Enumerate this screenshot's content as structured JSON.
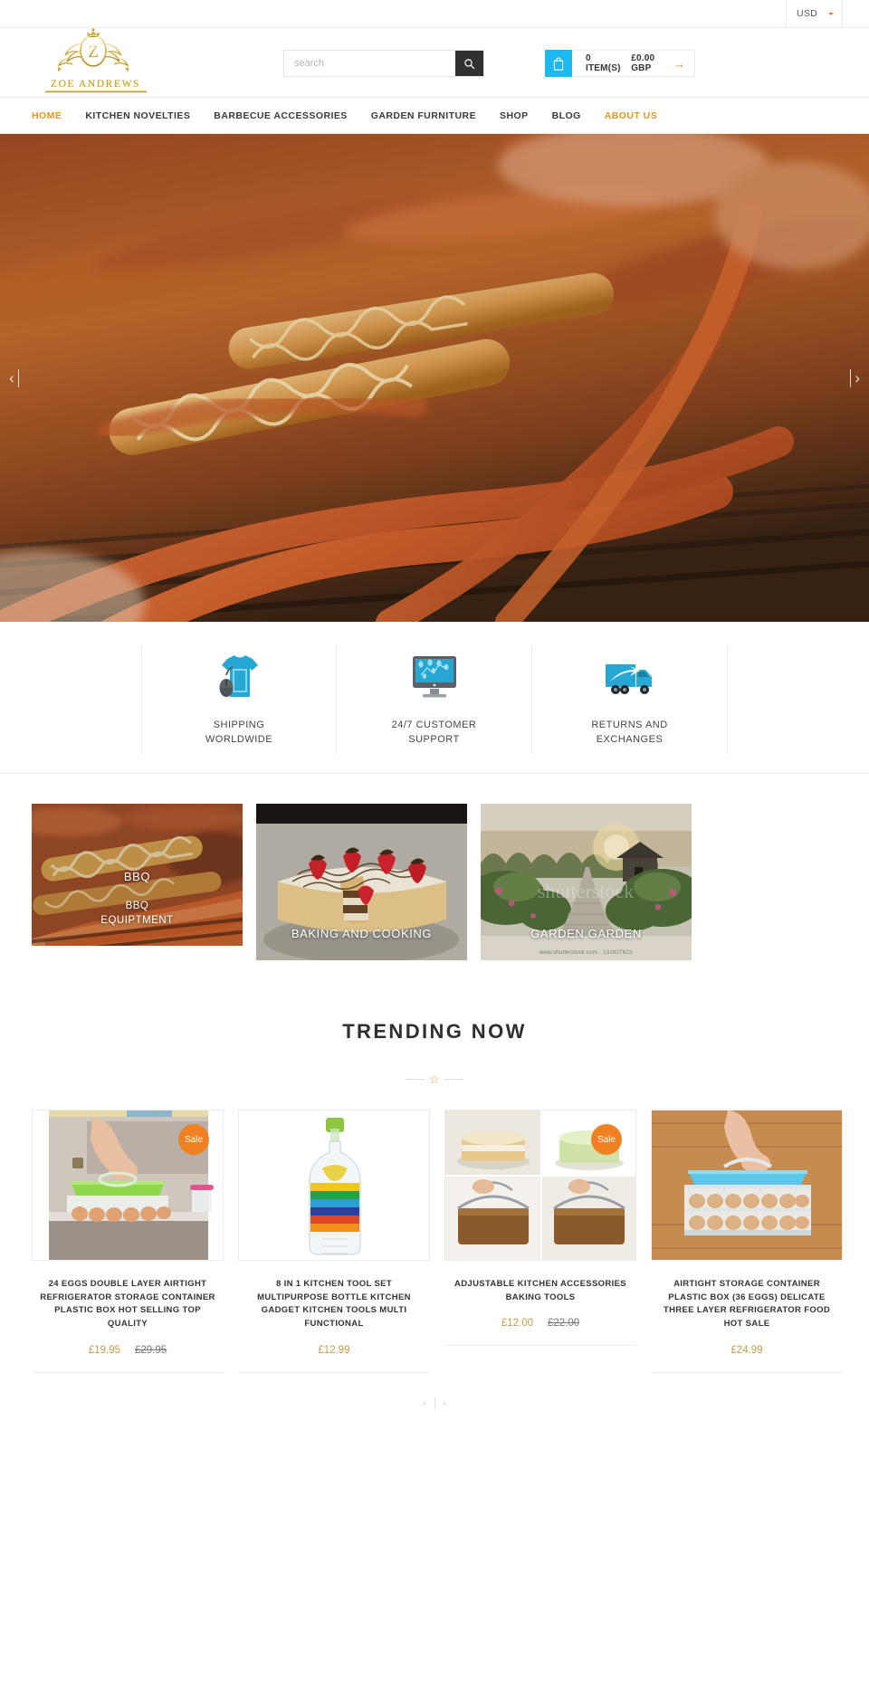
{
  "topbar": {
    "currency": "USD",
    "currency_icon": "chevron-down-icon"
  },
  "header": {
    "brand_name": "ZOE ANDREWS",
    "search": {
      "placeholder": "search",
      "value": "",
      "button_icon": "search-icon"
    },
    "cart": {
      "icon": "shopping-bag-icon",
      "items_label": "0 ITEM(S)",
      "total": "£0.00 GBP",
      "arrow_icon": "arrow-right-icon"
    }
  },
  "nav": {
    "items": [
      {
        "label": "HOME",
        "active": true
      },
      {
        "label": "KITCHEN NOVELTIES",
        "active": false
      },
      {
        "label": "BARBECUE ACCESSORIES",
        "active": false
      },
      {
        "label": "GARDEN FURNITURE",
        "active": false
      },
      {
        "label": "SHOP",
        "active": false
      },
      {
        "label": "BLOG",
        "active": false
      },
      {
        "label": "ABOUT US",
        "active": true
      }
    ]
  },
  "hero": {
    "prev_icon": "chevron-left-icon",
    "next_icon": "chevron-right-icon",
    "alt": "grilled sausages and corn on barbecue"
  },
  "services": [
    {
      "icon": "tshirt-mouse-icon",
      "line1": "SHIPPING",
      "line2": "WORLDWIDE"
    },
    {
      "icon": "monitor-support-icon",
      "line1": "24/7 CUSTOMER",
      "line2": "SUPPORT"
    },
    {
      "icon": "delivery-truck-icon",
      "line1": "RETURNS AND",
      "line2": "EXCHANGES"
    }
  ],
  "categories": [
    {
      "title": "BBQ",
      "subtitle_line1": "BBQ",
      "subtitle_line2": "EQUIPTMENT"
    },
    {
      "title": "BAKING AND COOKING",
      "subtitle_line1": "",
      "subtitle_line2": ""
    },
    {
      "title": "GARDEN GARDEN",
      "subtitle_line1": "",
      "subtitle_line2": ""
    }
  ],
  "trending": {
    "heading": "TRENDING NOW",
    "divider_icon": "star-icon"
  },
  "products": [
    {
      "title": "24 EGGS DOUBLE LAYER AIRTIGHT REFRIGERATOR STORAGE CONTAINER PLASTIC BOX HOT SELLING TOP QUALITY",
      "price": "£19.95",
      "old_price": "£29.95",
      "badge": "Sale"
    },
    {
      "title": "8 IN 1 KITCHEN TOOL SET MULTIPURPOSE BOTTLE KITCHEN GADGET KITCHEN TOOLS MULTI FUNCTIONAL",
      "price": "£12.99",
      "old_price": "",
      "badge": ""
    },
    {
      "title": "ADJUSTABLE KITCHEN ACCESSORIES BAKING TOOLS",
      "price": "£12.00",
      "old_price": "£22.00",
      "badge": "Sale"
    },
    {
      "title": "AIRTIGHT STORAGE CONTAINER PLASTIC BOX (36 EGGS) DELICATE THREE LAYER REFRIGERATOR FOOD HOT SALE",
      "price": "£24.99",
      "old_price": "",
      "badge": ""
    }
  ],
  "product_slider": {
    "prev_icon": "chevron-left-icon",
    "next_icon": "chevron-right-icon"
  },
  "colors": {
    "accent_orange": "#e8951e",
    "cart_blue": "#1eb8ef",
    "price_gold": "#c79a4b",
    "sale_badge": "#f08122",
    "logo_gold": "#c9a227"
  }
}
